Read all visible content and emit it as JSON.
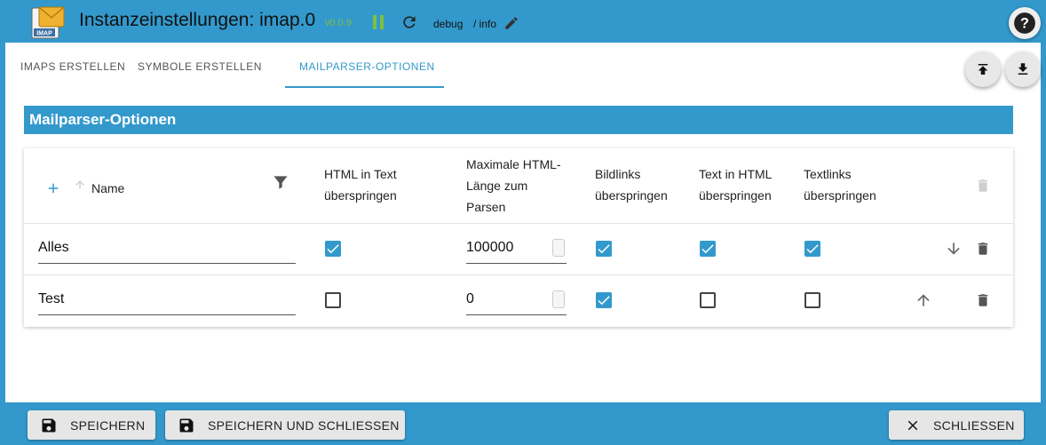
{
  "header": {
    "title": "Instanzeinstellungen: imap.0",
    "version": "v0.0.9",
    "log_level": "debug",
    "log_level_suffix": "/ info",
    "logo_text": "IMAP"
  },
  "tabs": [
    {
      "label": "IMAPS ERSTELLEN",
      "active": false
    },
    {
      "label": "SYMBOLE ERSTELLEN",
      "active": false
    },
    {
      "label": "MAILPARSER-OPTIONEN",
      "active": true
    }
  ],
  "section": {
    "title": "Mailparser-Optionen"
  },
  "table": {
    "columns": {
      "name": "Name",
      "html_in_text_1": "HTML in Text",
      "html_in_text_2": "überspringen",
      "max_len_1": "Maximale HTML-",
      "max_len_2": "Länge zum",
      "max_len_3": "Parsen",
      "bildlinks_1": "Bildlinks",
      "bildlinks_2": "überspringen",
      "text_in_html_1": "Text in HTML",
      "text_in_html_2": "überspringen",
      "textlinks_1": "Textlinks",
      "textlinks_2": "überspringen"
    },
    "rows": [
      {
        "name": "Alles",
        "html_in_text": true,
        "max_len": "100000",
        "bildlinks": true,
        "text_in_html": true,
        "textlinks": true
      },
      {
        "name": "Test",
        "html_in_text": false,
        "max_len": "0",
        "bildlinks": true,
        "text_in_html": false,
        "textlinks": false
      }
    ]
  },
  "footer": {
    "save": "SPEICHERN",
    "save_close": "SPEICHERN UND SCHLIESSEN",
    "close": "SCHLIESSEN"
  },
  "colors": {
    "accent": "#3399cc",
    "version": "#7fbf3f"
  }
}
